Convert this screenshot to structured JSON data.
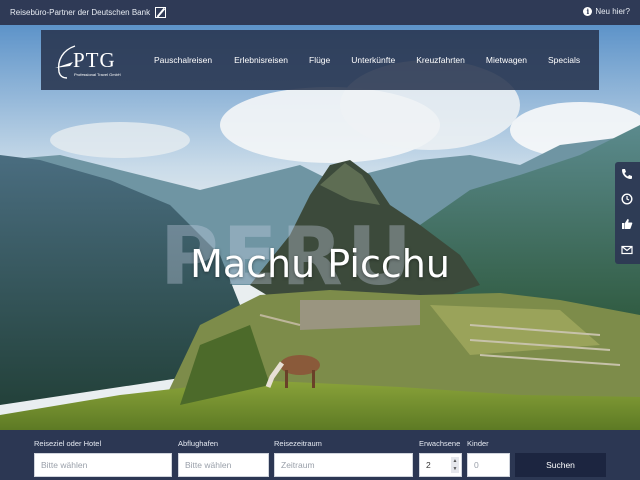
{
  "topbar": {
    "partner_text": "Reisebüro-Partner der Deutschen Bank",
    "new_here": "Neu hier?"
  },
  "logo": {
    "name": "PTG",
    "tagline": "Professional Travel GmbH"
  },
  "nav": {
    "items": [
      {
        "label": "Pauschalreisen"
      },
      {
        "label": "Erlebnisreisen"
      },
      {
        "label": "Flüge"
      },
      {
        "label": "Unterkünfte"
      },
      {
        "label": "Kreuzfahrten"
      },
      {
        "label": "Mietwagen"
      },
      {
        "label": "Specials"
      }
    ]
  },
  "hero": {
    "watermark": "PERU",
    "title": "Machu Picchu"
  },
  "side_widget": {
    "icons": [
      "phone-icon",
      "clock-icon",
      "thumbs-up-icon",
      "mail-icon"
    ]
  },
  "search": {
    "destination": {
      "label": "Reiseziel oder Hotel",
      "placeholder": "Bitte wählen"
    },
    "departure": {
      "label": "Abflughafen",
      "placeholder": "Bitte wählen"
    },
    "period": {
      "label": "Reisezeitraum",
      "placeholder": "Zeitraum"
    },
    "adults": {
      "label": "Erwachsene",
      "value": "2"
    },
    "children": {
      "label": "Kinder",
      "value": "0"
    },
    "submit_label": "Suchen"
  },
  "colors": {
    "topbar_bg": "#2f3a56",
    "nav_bg": "#28344e",
    "search_bg": "#2c3753",
    "button_bg": "#1c2540"
  }
}
